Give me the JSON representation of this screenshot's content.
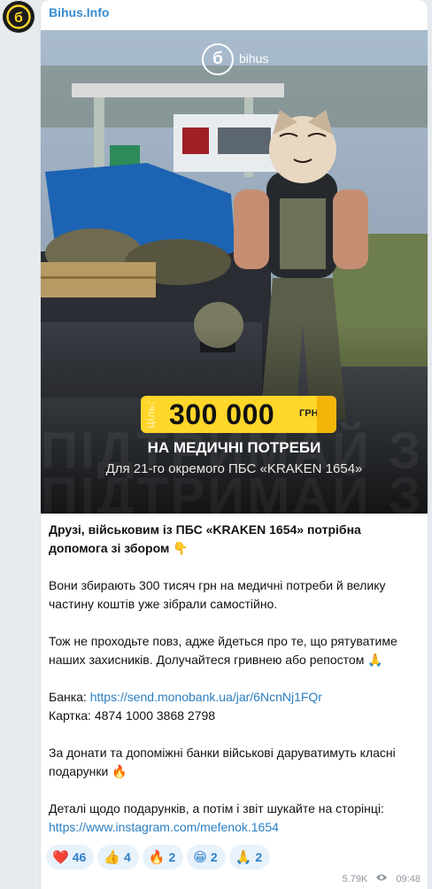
{
  "channel": {
    "name": "Bihus.Info",
    "avatar_glyph": "б"
  },
  "photo": {
    "logo_glyph": "б",
    "logo_word": "bihus",
    "goal_prefix": "Ціль:",
    "goal_amount": "300 000",
    "goal_currency": "ГРН",
    "headline": "НА МЕДИЧНІ ПОТРЕБИ",
    "subline": "Для 21-го окремого ПБС «KRAKEN 1654»",
    "colors": {
      "pill": "#ffd62a",
      "pill_edge": "#f3b50a",
      "sky": "#9fb2c6",
      "tarp": "#1d63b3"
    }
  },
  "message": {
    "p1": "Друзі, військовим із ПБС «KRAKEN 1654» потрібна допомога зі збором 👇",
    "p2": "Вони збирають 300 тисяч грн на медичні потреби й велику частину коштів уже зібрали самостійно.",
    "p3": "Тож не проходьте повз, адже йдеться про те, що рятуватиме наших захисників. Долучайтеся гривнею або репостом 🙏",
    "bank_label": "Банка:",
    "bank_link": "https://send.monobank.ua/jar/6NcnNj1FQr",
    "card_line": "Картка: 4874 1000 3868 2798",
    "p5": "За донати та допоміжні банки військові даруватимуть класні подарунки 🔥",
    "p6": "Деталі щодо подарунків, а потім і звіт шукайте на сторінці:",
    "insta_link": "https://www.instagram.com/mefenok.1654"
  },
  "reactions": [
    {
      "emoji": "❤️",
      "count": "46"
    },
    {
      "emoji": "👍",
      "count": "4"
    },
    {
      "emoji": "🔥",
      "count": "2"
    },
    {
      "emoji": "😁",
      "count": "2"
    },
    {
      "emoji": "🙏",
      "count": "2"
    }
  ],
  "meta": {
    "views": "5.79K",
    "views_icon": "eye-icon",
    "time": "09:48"
  },
  "theme": {
    "accent": "#3a8ccf",
    "link": "#2b7fc2",
    "reaction_bg": "#e8f2fb"
  }
}
